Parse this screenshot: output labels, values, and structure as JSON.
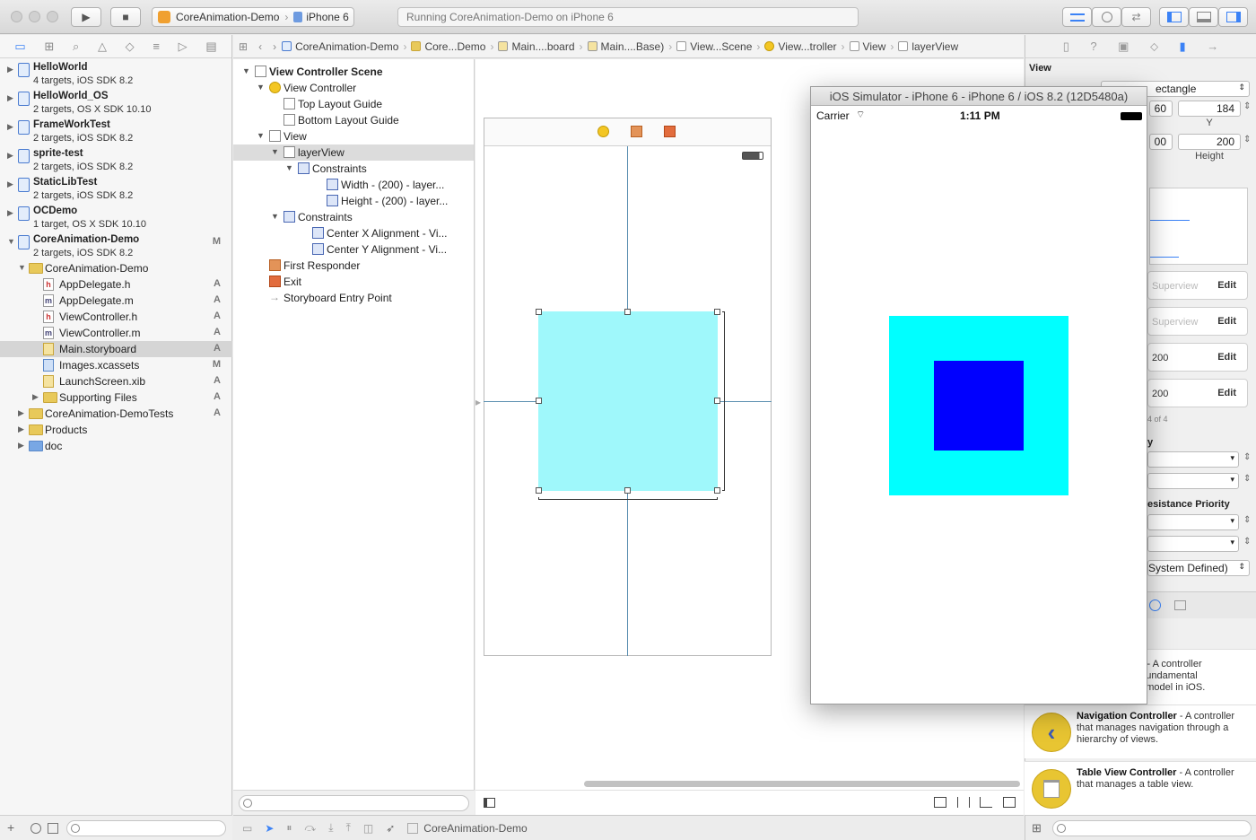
{
  "toolbar": {
    "run_glyph": "▶",
    "stop_glyph": "■",
    "scheme_project": "CoreAnimation-Demo",
    "scheme_device": "iPhone 6",
    "activity": "Running CoreAnimation-Demo on iPhone 6"
  },
  "navigator": {
    "projects": [
      {
        "name": "HelloWorld",
        "sub": "4 targets, iOS SDK 8.2",
        "badge": ""
      },
      {
        "name": "HelloWorld_OS",
        "sub": "2 targets, OS X SDK 10.10",
        "badge": ""
      },
      {
        "name": "FrameWorkTest",
        "sub": "2 targets, iOS SDK 8.2",
        "badge": ""
      },
      {
        "name": "sprite-test",
        "sub": "2 targets, iOS SDK 8.2",
        "badge": ""
      },
      {
        "name": "StaticLibTest",
        "sub": "2 targets, iOS SDK 8.2",
        "badge": ""
      },
      {
        "name": "OCDemo",
        "sub": "1 target, OS X SDK 10.10",
        "badge": ""
      },
      {
        "name": "CoreAnimation-Demo",
        "sub": "2 targets, iOS SDK 8.2",
        "badge": "M"
      }
    ],
    "files": [
      {
        "label": "CoreAnimation-Demo",
        "badge": "",
        "type": "folder"
      },
      {
        "label": "AppDelegate.h",
        "badge": "A",
        "type": "h"
      },
      {
        "label": "AppDelegate.m",
        "badge": "A",
        "type": "m"
      },
      {
        "label": "ViewController.h",
        "badge": "A",
        "type": "h"
      },
      {
        "label": "ViewController.m",
        "badge": "A",
        "type": "m"
      },
      {
        "label": "Main.storyboard",
        "badge": "A",
        "type": "sb"
      },
      {
        "label": "Images.xcassets",
        "badge": "M",
        "type": "xc"
      },
      {
        "label": "LaunchScreen.xib",
        "badge": "A",
        "type": "xib"
      },
      {
        "label": "Supporting Files",
        "badge": "A",
        "type": "folder"
      },
      {
        "label": "CoreAnimation-DemoTests",
        "badge": "A",
        "type": "folder"
      },
      {
        "label": "Products",
        "badge": "",
        "type": "folder"
      },
      {
        "label": "doc",
        "badge": "",
        "type": "folder-blue"
      }
    ]
  },
  "jumpbar": {
    "crumbs": [
      "CoreAnimation-Demo",
      "Core...Demo",
      "Main....board",
      "Main....Base)",
      "View...Scene",
      "View...troller",
      "View",
      "layerView"
    ]
  },
  "outline": {
    "items": [
      {
        "label": "View Controller Scene"
      },
      {
        "label": "View Controller"
      },
      {
        "label": "Top Layout Guide"
      },
      {
        "label": "Bottom Layout Guide"
      },
      {
        "label": "View"
      },
      {
        "label": "layerView"
      },
      {
        "label": "Constraints"
      },
      {
        "label": "Width - (200) - layer..."
      },
      {
        "label": "Height - (200) - layer..."
      },
      {
        "label": "Constraints"
      },
      {
        "label": "Center X Alignment - Vi..."
      },
      {
        "label": "Center Y Alignment - Vi..."
      },
      {
        "label": "First Responder"
      },
      {
        "label": "Exit"
      },
      {
        "label": "Storyboard Entry Point"
      }
    ]
  },
  "debugbar": {
    "target": "CoreAnimation-Demo"
  },
  "simulator": {
    "title": "iOS Simulator - iPhone 6 - iPhone 6 / iOS 8.2 (12D5480a)",
    "carrier": "Carrier",
    "time": "1:11 PM",
    "outer_color": "#00ffff",
    "inner_color": "#0000ff"
  },
  "utilities": {
    "section_title": "View",
    "shape_value": "ectangle",
    "x_partial": "60",
    "y_value": "184",
    "y_label": "Y",
    "w_partial": "00",
    "height_value": "200",
    "height_label": "Height",
    "constraint_superview": "Superview",
    "constraint_edit": "Edit",
    "constraint_value": "200",
    "count_text": "4 of 4",
    "letter_y": "y",
    "resistance_label": "esistance Priority",
    "system_defined": "System Defined)",
    "library": [
      {
        "title": "er",
        "desc": " - A controller\ne fundamental\nnt model in iOS."
      },
      {
        "title": "Navigation Controller",
        "desc": " - A controller that manages navigation through a hierarchy of views."
      },
      {
        "title": "Table View Controller",
        "desc": " - A controller that manages a table view."
      }
    ]
  }
}
